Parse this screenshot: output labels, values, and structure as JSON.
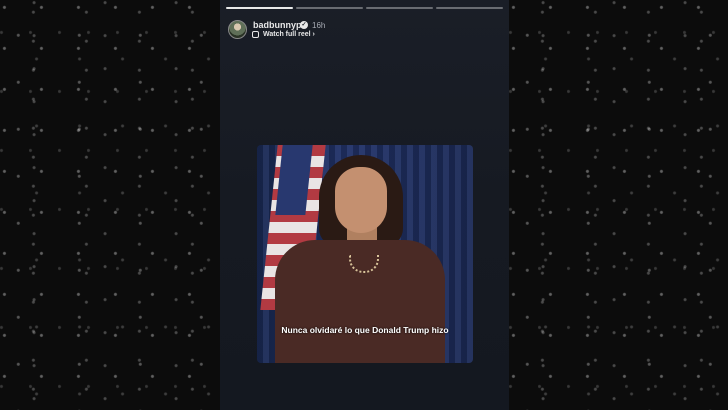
{
  "story": {
    "username": "badbunnypr",
    "time_ago": "16h",
    "watch_label": "Watch full reel ›",
    "progress": {
      "segments": 4,
      "active_index": 0
    }
  },
  "video": {
    "subtitle": "Nunca olvidaré lo que Donald Trump hizo"
  },
  "icons": {
    "verified": "verified-badge-icon",
    "reel": "reel-icon"
  },
  "colors": {
    "story_bg": "#161a22",
    "text_primary": "#e8e8e8",
    "text_secondary": "#a9adb5"
  }
}
